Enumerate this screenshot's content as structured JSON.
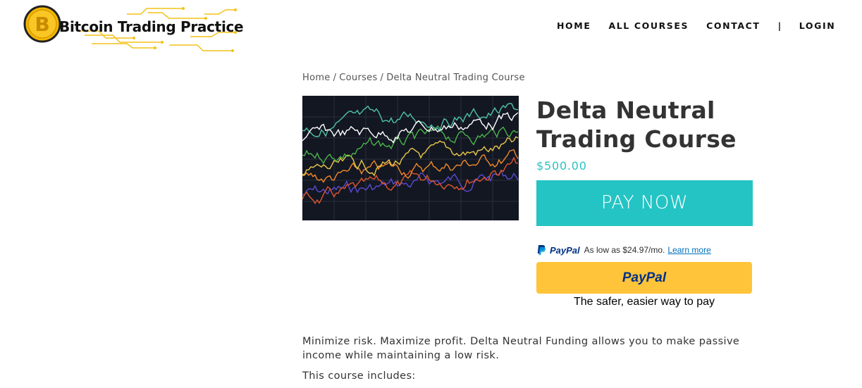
{
  "header": {
    "logo_text": "Bitcoin Trading Practice",
    "nav": {
      "home": "HOME",
      "all_courses": "ALL COURSES",
      "contact": "CONTACT",
      "separator": "|",
      "login": "LOGIN"
    }
  },
  "breadcrumb": {
    "home": "Home",
    "sep1": "/",
    "courses": "Courses",
    "sep2": "/",
    "current": "Delta Neutral Trading Course"
  },
  "product": {
    "title": "Delta Neutral Trading Course",
    "price": "$500.00",
    "pay_now_label": "PAY NOW",
    "image_icon": "multi-line-price-chart-image"
  },
  "paypal": {
    "paylater_logo": "PayPal",
    "paylater_text": "As low as $24.97/mo.",
    "learn_more": "Learn more",
    "button_logo": "PayPal",
    "tagline": "The safer, easier way to pay"
  },
  "description": {
    "paragraph1": "Minimize risk. Maximize profit. Delta Neutral Funding allows you to make passive income while maintaining a low risk.",
    "paragraph2": "This course includes:"
  },
  "colors": {
    "accent": "#25c4c4",
    "paypal_yellow": "#ffc439",
    "paypal_dark_blue": "#003087",
    "paypal_light_blue": "#009cde"
  }
}
